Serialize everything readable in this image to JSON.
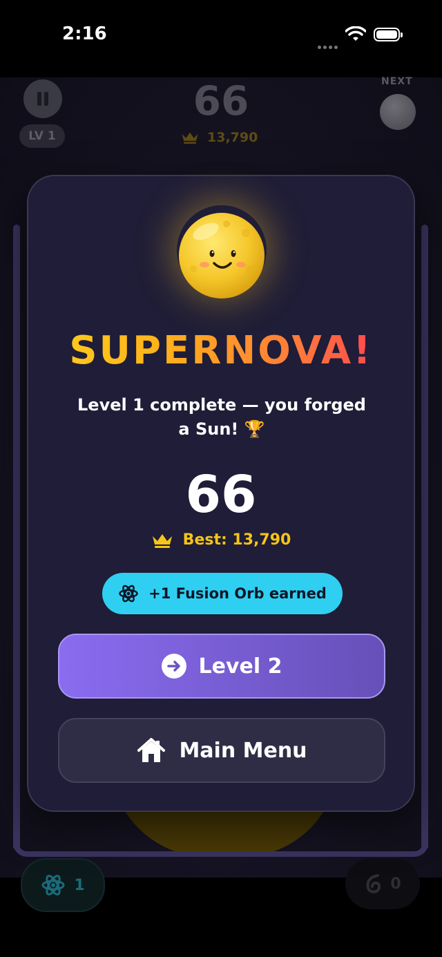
{
  "status_bar": {
    "time": "2:16"
  },
  "hud": {
    "level_badge": "LV 1",
    "score": "66",
    "best": "13,790",
    "next_label": "NEXT"
  },
  "bottom": {
    "fusion_orbs": "1",
    "swirls": "0"
  },
  "modal": {
    "title": "SUPERNOVA!",
    "subtitle": "Level 1 complete — you forged a Sun! 🏆",
    "score": "66",
    "best": "Best: 13,790",
    "orb_earned": "+1 Fusion Orb earned",
    "next_button": "Level 2",
    "menu_button": "Main Menu"
  },
  "colors": {
    "accent_purple": "#8a6cf0",
    "accent_cyan": "#2fcff2",
    "gold": "#f5c518",
    "background": "#14121f"
  },
  "icons": [
    "pause-icon",
    "crown-icon",
    "atom-icon",
    "arrow-right-icon",
    "home-icon",
    "swirl-icon",
    "wifi-icon",
    "battery-icon",
    "trophy-icon"
  ]
}
